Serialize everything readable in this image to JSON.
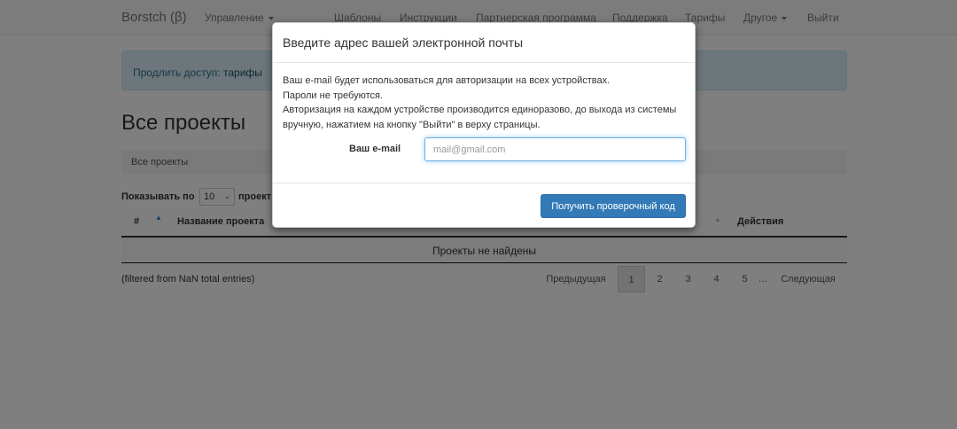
{
  "navbar": {
    "brand": "Borstch (β)",
    "management": "Управление",
    "templates": "Шаблоны",
    "instructions": "Инструкции",
    "partner": "Партнерская программа",
    "support": "Поддержка",
    "pricing": "Тарифы",
    "other": "Другое",
    "logout": "Выйти"
  },
  "alert": {
    "prefix": "Продлить доступ:",
    "link": "тарифы"
  },
  "main": {
    "title": "Все проекты",
    "breadcrumb": "Все проекты",
    "show_label": "Показывать по",
    "page_length": "10",
    "show_suffix": "проект",
    "table": {
      "col_num": "#",
      "col_name": "Название проекта",
      "col_actions": "Действия",
      "empty": "Проекты не найдены"
    },
    "info": "(filtered from NaN total entries)",
    "pagination": {
      "prev": "Предыдущая",
      "pages": [
        "1",
        "2",
        "3",
        "4",
        "5"
      ],
      "ellipsis": "…",
      "next": "Следующая"
    }
  },
  "modal": {
    "title": "Введите адрес вашей электронной почты",
    "line1": "Ваш e-mail будет использоваться для авторизации на всех устройствах.",
    "line2": "Пароли не требуются.",
    "line3": "Авторизация на каждом устройстве производится единоразово, до выхода из системы вручную, нажатием на кнопку \"Выйти\" в верху страницы.",
    "email_label": "Ваш e-mail",
    "email_placeholder": "mail@gmail.com",
    "email_value": "",
    "submit": "Получить проверочный код"
  },
  "colors": {
    "primary": "#337ab7",
    "alert_bg": "#d9edf7",
    "backdrop": "rgba(0,0,0,0.5)"
  }
}
